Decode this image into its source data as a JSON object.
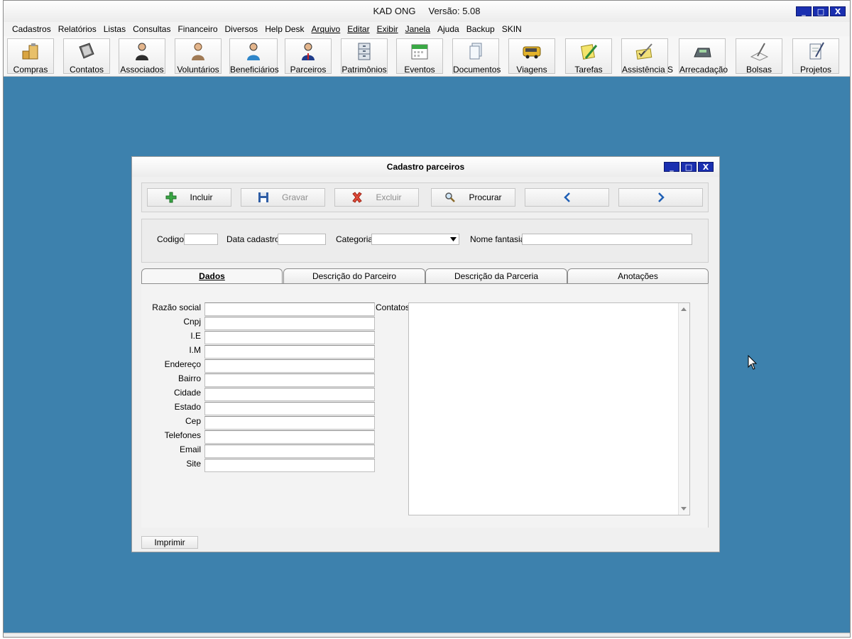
{
  "app": {
    "title": "KAD ONG     Versão: 5.08",
    "window_buttons": [
      "_",
      "□",
      "X"
    ]
  },
  "menu": [
    "Cadastros",
    "Relatórios",
    "Listas",
    "Consultas",
    "Financeiro",
    "Diversos",
    "Help Desk",
    "Arquivo",
    "Editar",
    "Exibir",
    "Janela",
    "Ajuda",
    "Backup",
    "SKIN"
  ],
  "toolbar": [
    {
      "label": "Compras",
      "icon": "boxes-clipboard-icon"
    },
    {
      "label": "Contatos",
      "icon": "address-book-icon"
    },
    {
      "label": "Associados",
      "icon": "person-suit-icon"
    },
    {
      "label": "Voluntários",
      "icon": "person-icon"
    },
    {
      "label": "Beneficiários",
      "icon": "person-blue-icon"
    },
    {
      "label": "Parceiros",
      "icon": "person-tie-icon"
    },
    {
      "label": "Patrimônios",
      "icon": "cabinet-icon"
    },
    {
      "label": "Eventos",
      "icon": "calendar-icon"
    },
    {
      "label": "Documentos",
      "icon": "documents-icon"
    },
    {
      "label": "Viagens",
      "icon": "bus-icon"
    },
    {
      "label": "Tarefas",
      "icon": "notepad-pencil-icon"
    },
    {
      "label": "Assistência S",
      "icon": "checklist-pen-icon"
    },
    {
      "label": "Arrecadação",
      "icon": "cash-register-icon"
    },
    {
      "label": "Bolsas",
      "icon": "pen-paper-icon"
    },
    {
      "label": "Projetos",
      "icon": "notebook-pen-icon"
    }
  ],
  "child_window": {
    "title": "Cadastro parceiros",
    "actions": {
      "incluir": "Incluir",
      "gravar": "Gravar",
      "excluir": "Excluir",
      "procurar": "Procurar"
    },
    "header_fields": {
      "codigo_label": "Codigo",
      "codigo_value": "",
      "data_label": "Data cadastro",
      "data_value": "",
      "categoria_label": "Categoria",
      "categoria_value": "",
      "nome_label": "Nome fantasia",
      "nome_value": ""
    },
    "tabs": [
      "Dados",
      "Descrição do Parceiro",
      "Descrição da Parceria",
      "Anotações"
    ],
    "active_tab": "Dados",
    "form_labels": [
      "Razão social",
      "Cnpj",
      "I.E",
      "I.M",
      "Endereço",
      "Bairro",
      "Cidade",
      "Estado",
      "Cep",
      "Telefones",
      "Email",
      "Site"
    ],
    "contatos_label": "Contatos",
    "print_label": "Imprimir"
  },
  "colors": {
    "desktop": "#3d81ad",
    "window_button": "#1a2fb0"
  }
}
